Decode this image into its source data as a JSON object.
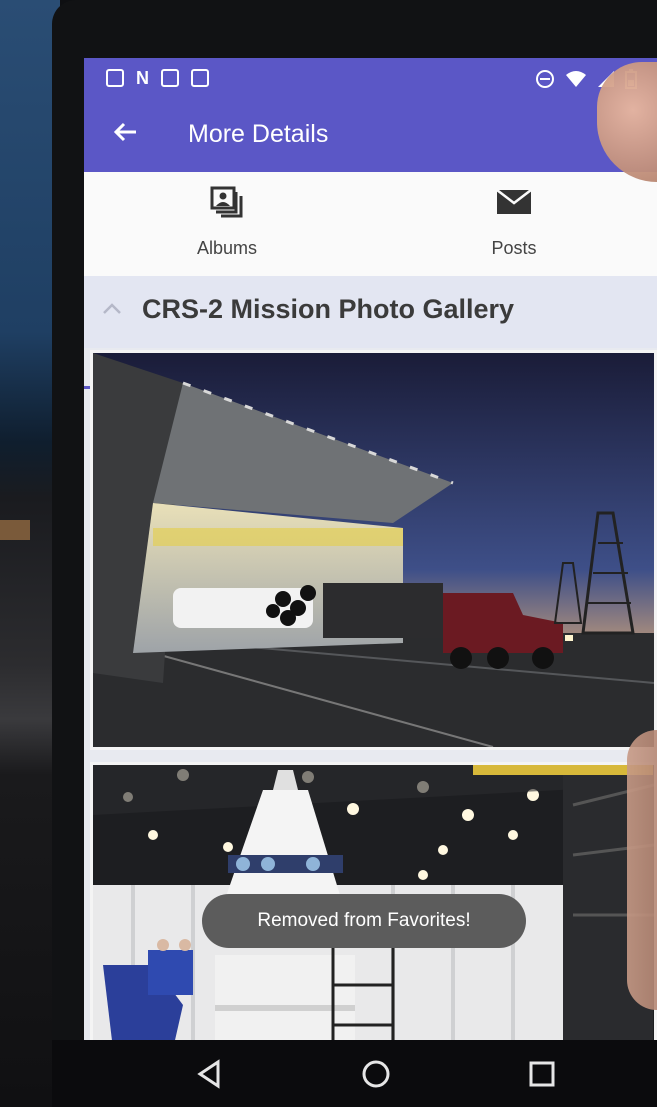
{
  "appbar": {
    "title": "More Details"
  },
  "tabs": [
    {
      "label": "Albums",
      "icon": "photo-album-icon",
      "selected": true
    },
    {
      "label": "Posts",
      "icon": "envelope-icon",
      "selected": false
    }
  ],
  "section": {
    "title": "CRS-2 Mission Photo Gallery",
    "icon": "chevron-up-icon"
  },
  "toast": {
    "message": "Removed from Favorites!"
  },
  "colors": {
    "primary": "#5b57c6",
    "toast": "#5c5c5c"
  }
}
